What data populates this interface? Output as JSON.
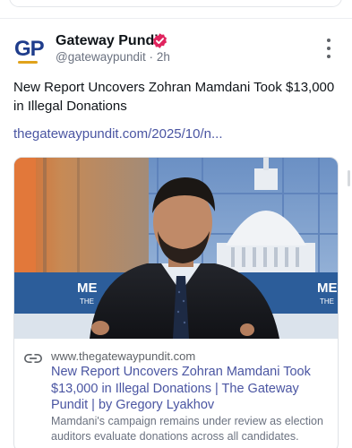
{
  "post": {
    "author": {
      "display_name": "Gateway Pundit",
      "handle": "@gatewaypundit",
      "separator": "·",
      "timestamp": "2h",
      "avatar_text": "GP",
      "verified": true,
      "avatar_icon": "gateway-pundit-logo"
    },
    "text": "New Report Uncovers Zohran Mamdani Took $13,000 in Illegal Donations",
    "link_text": "thegatewaypundit.com/2025/10/n...",
    "more_icon": "vertical-ellipsis-icon"
  },
  "link_card": {
    "domain": "www.thegatewaypundit.com",
    "title": "New Report Uncovers Zohran Mamdani Took $13,000 in Illegal Donations | The Gateway Pundit | by Gregory Lyakhov",
    "description": "Mamdani's campaign remains under review as election auditors evaluate donations across all candidates.",
    "link_icon": "link-chain-icon",
    "image_overlay_texts": [
      "ME THE",
      "ME THE"
    ]
  },
  "colors": {
    "link": "#4a55a2",
    "muted": "#6b7280",
    "verified_badge": "#e0245e",
    "gp_blue": "#1f3d8c",
    "gp_gold": "#e0a21b"
  }
}
